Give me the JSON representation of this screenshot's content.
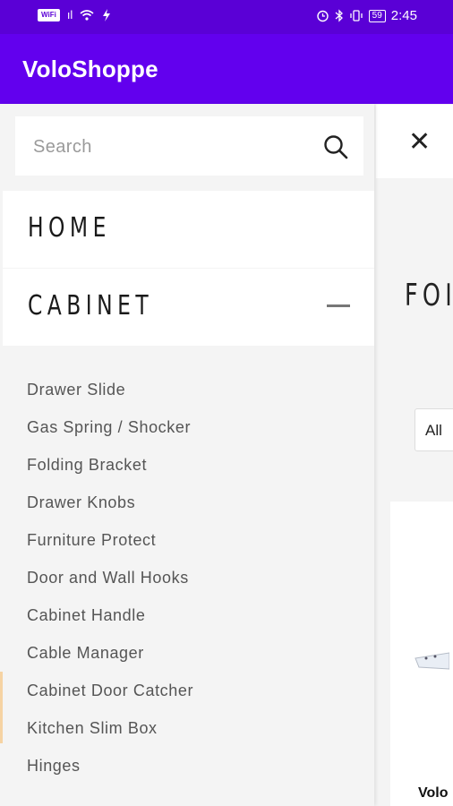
{
  "status_bar": {
    "wifi_badge": "WiFi",
    "signal": "ıl",
    "left_icons": [
      "sim-icon",
      "signal-icon",
      "wifi-icon",
      "charging-icon"
    ],
    "right_icons": [
      "alarm-icon",
      "bluetooth-icon",
      "vibrate-icon"
    ],
    "battery": "59",
    "time": "2:45"
  },
  "app_bar": {
    "title": "VoloShoppe"
  },
  "drawer": {
    "search": {
      "placeholder": "Search",
      "value": ""
    },
    "menu": [
      {
        "label": "HOME"
      },
      {
        "label": "CABINET",
        "expanded": true
      }
    ],
    "sub_items": [
      "Drawer Slide",
      "Gas Spring / Shocker",
      "Folding Bracket",
      "Drawer Knobs",
      "Furniture Protect",
      "Door and Wall Hooks",
      "Cabinet Handle",
      "Cable Manager",
      "Cabinet Door Catcher",
      "Kitchen Slim Box",
      "Hinges"
    ]
  },
  "background": {
    "heading_fragment": "FOI",
    "filter_fragment": "All",
    "product_fragment": "Volo"
  },
  "colors": {
    "status_bar": "#5a00d6",
    "app_bar": "#6200ee",
    "drawer_bg": "#f4f4f4"
  }
}
